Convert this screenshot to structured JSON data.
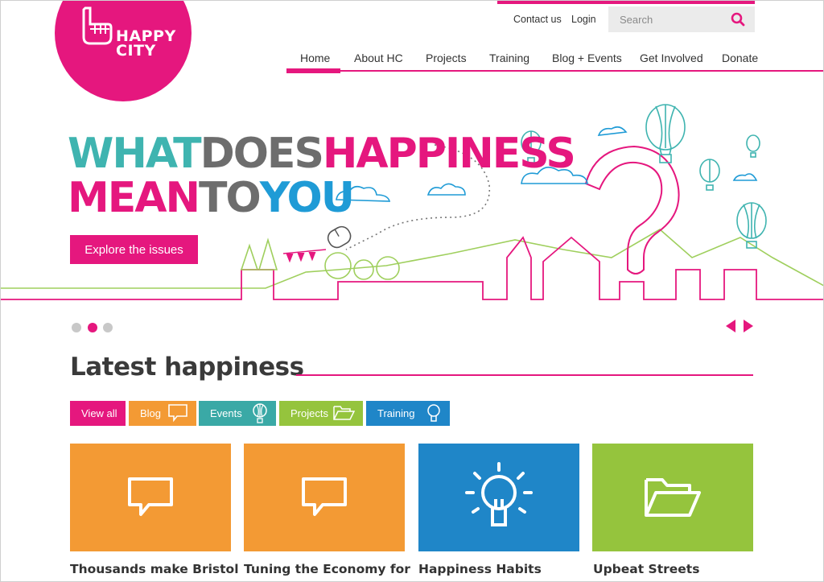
{
  "brand": {
    "logo_text": [
      "HAPPY",
      "CITY"
    ],
    "accent": "#e5177e"
  },
  "utility": {
    "contact": "Contact us",
    "login": "Login"
  },
  "search": {
    "placeholder": "Search"
  },
  "nav": {
    "items": [
      "Home",
      "About HC",
      "Projects",
      "Training",
      "Blog + Events",
      "Get Involved",
      "Donate"
    ],
    "active": "Home"
  },
  "hero": {
    "line1": [
      "WHAT",
      "DOES",
      "HAPPINESS"
    ],
    "line2": [
      "MEAN",
      "TO",
      "YOU"
    ],
    "cta": "Explore the issues"
  },
  "slider": {
    "total": 3,
    "active": 2
  },
  "latest": {
    "title": "Latest happiness",
    "filters": [
      {
        "label": "View all",
        "color": "#e5177e",
        "icon": ""
      },
      {
        "label": "Blog",
        "color": "#f39a34",
        "icon": "speech-bubble-icon"
      },
      {
        "label": "Events",
        "color": "#3aa9a6",
        "icon": "balloon-icon"
      },
      {
        "label": "Projects",
        "color": "#95c43d",
        "icon": "folder-icon"
      },
      {
        "label": "Training",
        "color": "#1f86c8",
        "icon": "lightbulb-icon"
      }
    ],
    "cards": [
      {
        "title": "Thousands make Bristol",
        "color": "#f39a34",
        "icon": "speech-bubble-icon"
      },
      {
        "title": "Tuning the Economy for",
        "color": "#f39a34",
        "icon": "speech-bubble-icon"
      },
      {
        "title": "Happiness Habits",
        "color": "#1f86c8",
        "icon": "lightbulb-icon"
      },
      {
        "title": "Upbeat Streets",
        "color": "#95c43d",
        "icon": "folder-icon"
      }
    ]
  }
}
